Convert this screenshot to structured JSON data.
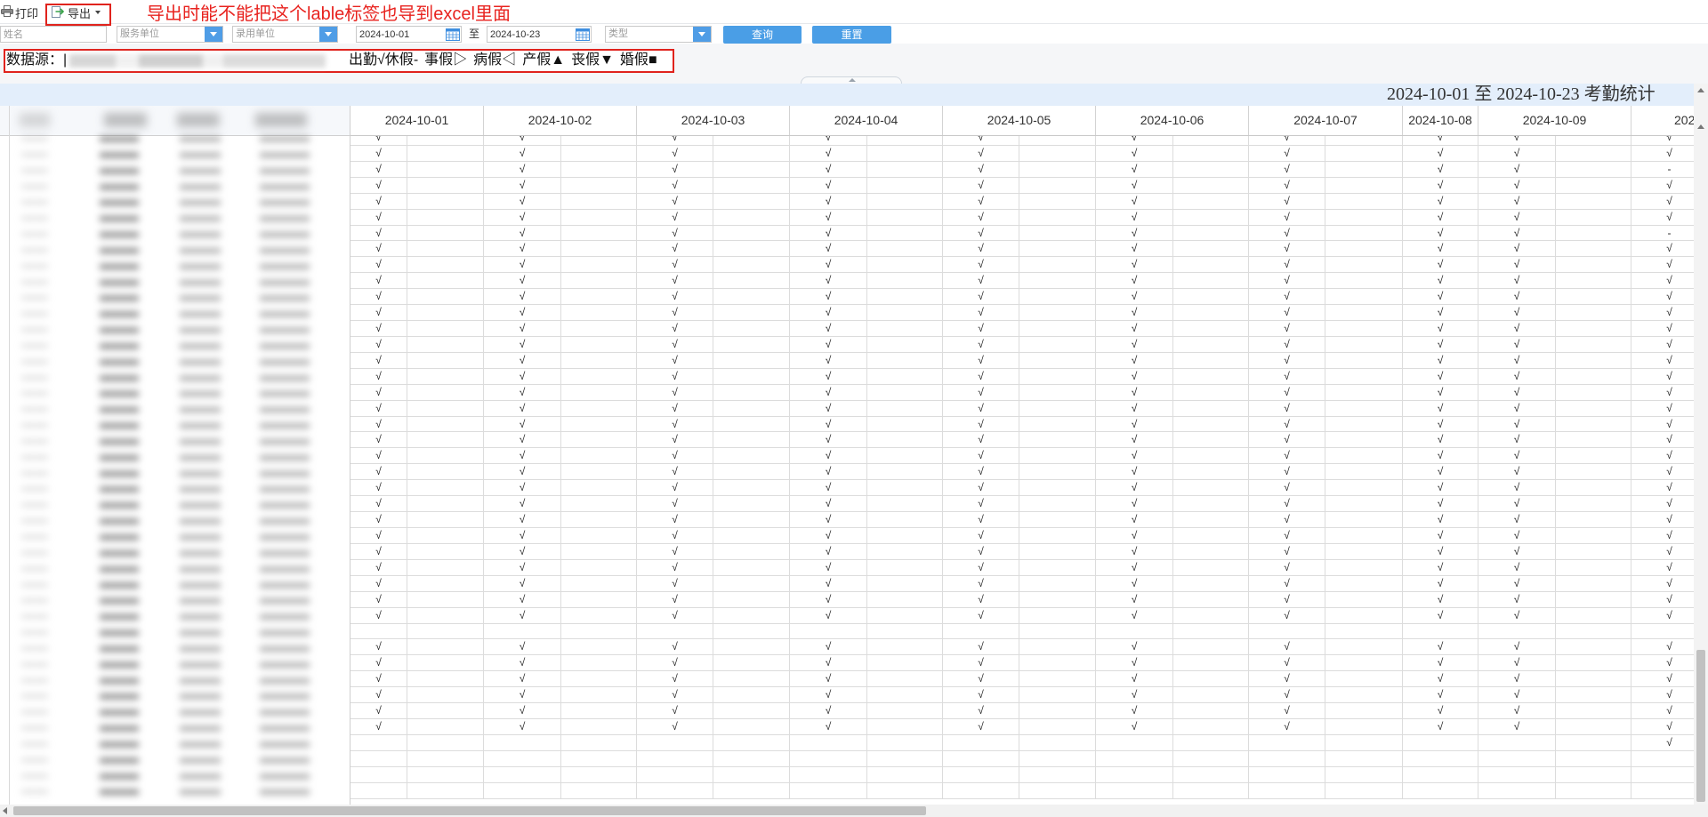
{
  "toolbar": {
    "print_label": "打印",
    "print_icon": "printer-icon",
    "export_label": "导出",
    "export_icon": "export-icon"
  },
  "annotation": {
    "text": "导出时能不能把这个lable标签也导到excel里面"
  },
  "filters": {
    "name_placeholder": "姓名",
    "service_unit_placeholder": "服务单位",
    "hiring_unit_placeholder": "录用单位",
    "date_from": "2024-10-01",
    "range_separator": "至",
    "date_to": "2024-10-23",
    "type_placeholder": "类型",
    "query_label": "查询",
    "reset_label": "重置",
    "dropdown_icon": "chevron-down-icon",
    "calendar_icon": "calendar-icon"
  },
  "legend": {
    "source_label": "数据源：|",
    "items": [
      {
        "label": "出勤",
        "symbol": "√"
      },
      {
        "label": "休假",
        "symbol": "-"
      },
      {
        "label": "事假",
        "symbol": "▷"
      },
      {
        "label": "病假",
        "symbol": "◁"
      },
      {
        "label": "产假",
        "symbol": "▲"
      },
      {
        "label": "丧假",
        "symbol": "▼"
      },
      {
        "label": "婚假",
        "symbol": "■"
      }
    ]
  },
  "report": {
    "title": "2024-10-01 至 2024-10-23 考勤统计"
  },
  "table": {
    "columns": [
      {
        "label": "2024-10-01"
      },
      {
        "label": "2024-10-02"
      },
      {
        "label": "2024-10-03"
      },
      {
        "label": "2024-10-04"
      },
      {
        "label": "2024-10-05"
      },
      {
        "label": "2024-10-06"
      },
      {
        "label": "2024-10-07"
      },
      {
        "label": "2024-10-08"
      },
      {
        "label": "2024-10-09"
      },
      {
        "label": "202"
      }
    ],
    "rows": [
      [
        "√",
        "√",
        "√",
        "√",
        "√",
        "√",
        "√",
        "√",
        "√",
        "√"
      ],
      [
        "√",
        "√",
        "√",
        "√",
        "√",
        "√",
        "√",
        "√",
        "√",
        "√"
      ],
      [
        "√",
        "√",
        "√",
        "√",
        "√",
        "√",
        "√",
        "√",
        "√",
        "-"
      ],
      [
        "√",
        "√",
        "√",
        "√",
        "√",
        "√",
        "√",
        "√",
        "√",
        "√"
      ],
      [
        "√",
        "√",
        "√",
        "√",
        "√",
        "√",
        "√",
        "√",
        "√",
        "√"
      ],
      [
        "√",
        "√",
        "√",
        "√",
        "√",
        "√",
        "√",
        "√",
        "√",
        "√"
      ],
      [
        "√",
        "√",
        "√",
        "√",
        "√",
        "√",
        "√",
        "√",
        "√",
        "-"
      ],
      [
        "√",
        "√",
        "√",
        "√",
        "√",
        "√",
        "√",
        "√",
        "√",
        "√"
      ],
      [
        "√",
        "√",
        "√",
        "√",
        "√",
        "√",
        "√",
        "√",
        "√",
        "√"
      ],
      [
        "√",
        "√",
        "√",
        "√",
        "√",
        "√",
        "√",
        "√",
        "√",
        "√"
      ],
      [
        "√",
        "√",
        "√",
        "√",
        "√",
        "√",
        "√",
        "√",
        "√",
        "√"
      ],
      [
        "√",
        "√",
        "√",
        "√",
        "√",
        "√",
        "√",
        "√",
        "√",
        "√"
      ],
      [
        "√",
        "√",
        "√",
        "√",
        "√",
        "√",
        "√",
        "√",
        "√",
        "√"
      ],
      [
        "√",
        "√",
        "√",
        "√",
        "√",
        "√",
        "√",
        "√",
        "√",
        "√"
      ],
      [
        "√",
        "√",
        "√",
        "√",
        "√",
        "√",
        "√",
        "√",
        "√",
        "√"
      ],
      [
        "√",
        "√",
        "√",
        "√",
        "√",
        "√",
        "√",
        "√",
        "√",
        "√"
      ],
      [
        "√",
        "√",
        "√",
        "√",
        "√",
        "√",
        "√",
        "√",
        "√",
        "√"
      ],
      [
        "√",
        "√",
        "√",
        "√",
        "√",
        "√",
        "√",
        "√",
        "√",
        "√"
      ],
      [
        "√",
        "√",
        "√",
        "√",
        "√",
        "√",
        "√",
        "√",
        "√",
        "√"
      ],
      [
        "√",
        "√",
        "√",
        "√",
        "√",
        "√",
        "√",
        "√",
        "√",
        "√"
      ],
      [
        "√",
        "√",
        "√",
        "√",
        "√",
        "√",
        "√",
        "√",
        "√",
        "√"
      ],
      [
        "√",
        "√",
        "√",
        "√",
        "√",
        "√",
        "√",
        "√",
        "√",
        "√"
      ],
      [
        "√",
        "√",
        "√",
        "√",
        "√",
        "√",
        "√",
        "√",
        "√",
        "√"
      ],
      [
        "√",
        "√",
        "√",
        "√",
        "√",
        "√",
        "√",
        "√",
        "√",
        "√"
      ],
      [
        "√",
        "√",
        "√",
        "√",
        "√",
        "√",
        "√",
        "√",
        "√",
        "√"
      ],
      [
        "√",
        "√",
        "√",
        "√",
        "√",
        "√",
        "√",
        "√",
        "√",
        "√"
      ],
      [
        "√",
        "√",
        "√",
        "√",
        "√",
        "√",
        "√",
        "√",
        "√",
        "√"
      ],
      [
        "√",
        "√",
        "√",
        "√",
        "√",
        "√",
        "√",
        "√",
        "√",
        "√"
      ],
      [
        "√",
        "√",
        "√",
        "√",
        "√",
        "√",
        "√",
        "√",
        "√",
        "√"
      ],
      [
        "√",
        "√",
        "√",
        "√",
        "√",
        "√",
        "√",
        "√",
        "√",
        "√"
      ],
      [
        "√",
        "√",
        "√",
        "√",
        "√",
        "√",
        "√",
        "√",
        "√",
        "√"
      ],
      [
        "",
        "",
        "",
        "",
        "",
        "",
        "",
        "",
        "",
        ""
      ],
      [
        "√",
        "√",
        "√",
        "√",
        "√",
        "√",
        "√",
        "√",
        "√",
        "√"
      ],
      [
        "√",
        "√",
        "√",
        "√",
        "√",
        "√",
        "√",
        "√",
        "√",
        "√"
      ],
      [
        "√",
        "√",
        "√",
        "√",
        "√",
        "√",
        "√",
        "√",
        "√",
        "√"
      ],
      [
        "√",
        "√",
        "√",
        "√",
        "√",
        "√",
        "√",
        "√",
        "√",
        "√"
      ],
      [
        "√",
        "√",
        "√",
        "√",
        "√",
        "√",
        "√",
        "√",
        "√",
        "√"
      ],
      [
        "√",
        "√",
        "√",
        "√",
        "√",
        "√",
        "√",
        "√",
        "√",
        "√"
      ],
      [
        "",
        "",
        "",
        "",
        "",
        "",
        "",
        "",
        "",
        "√"
      ],
      [
        "",
        "",
        "",
        "",
        "",
        "",
        "",
        "",
        "",
        ""
      ],
      [
        "",
        "",
        "",
        "",
        "",
        "",
        "",
        "",
        "",
        ""
      ],
      [
        "",
        "",
        "",
        "",
        "",
        "",
        "",
        "",
        "",
        ""
      ]
    ]
  },
  "colors": {
    "accent": "#4a9ee6",
    "annotation": "#e8231f",
    "title_band": "#e3eefb"
  }
}
